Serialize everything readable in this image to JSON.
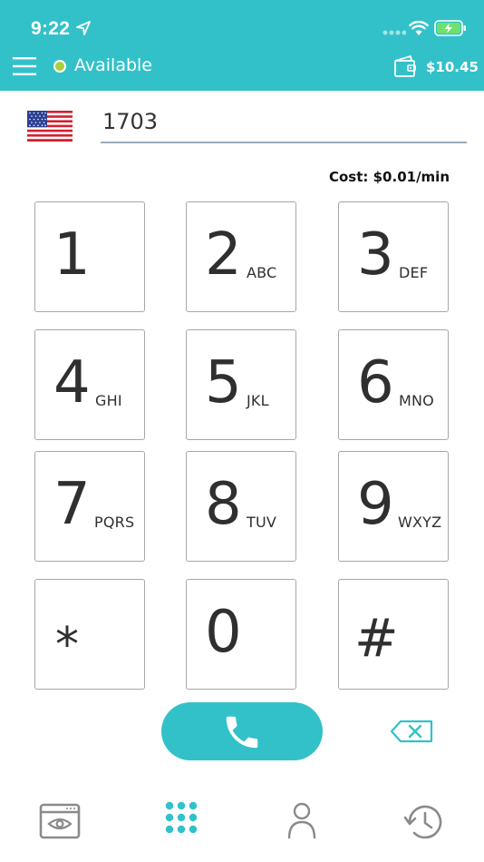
{
  "status_bar": {
    "time": "9:22"
  },
  "header": {
    "presence_label": "Available",
    "balance": "$10.45"
  },
  "dialer": {
    "number": "1703",
    "cost": "Cost: $0.01/min"
  },
  "keys": [
    {
      "digit": "1",
      "letters": ""
    },
    {
      "digit": "2",
      "letters": "ABC"
    },
    {
      "digit": "3",
      "letters": "DEF"
    },
    {
      "digit": "4",
      "letters": "GHI"
    },
    {
      "digit": "5",
      "letters": "JKL"
    },
    {
      "digit": "6",
      "letters": "MNO"
    },
    {
      "digit": "7",
      "letters": "PQRS"
    },
    {
      "digit": "8",
      "letters": "TUV"
    },
    {
      "digit": "9",
      "letters": "WXYZ"
    },
    {
      "digit": "*",
      "letters": ""
    },
    {
      "digit": "0",
      "letters": ""
    },
    {
      "digit": "#",
      "letters": ""
    }
  ],
  "colors": {
    "accent": "#33c1c9",
    "presence_available": "#a7cf3a",
    "battery_charging": "#6ee06e"
  },
  "icons": {
    "menu": "menu-icon",
    "wallet": "wallet-icon",
    "flag": "us-flag-icon",
    "call": "phone-icon",
    "backspace": "backspace-icon",
    "tabs": [
      "browser-eye-icon",
      "keypad-icon",
      "contact-icon",
      "history-icon"
    ]
  },
  "tabs": {
    "active_index": 1
  }
}
